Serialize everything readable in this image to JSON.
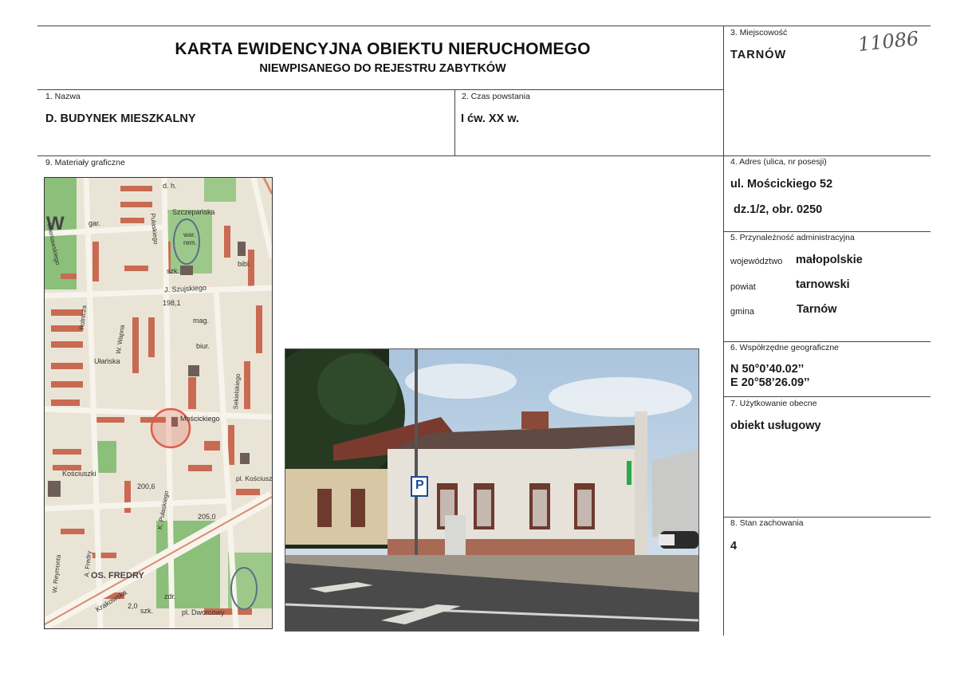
{
  "header": {
    "title": "KARTA EWIDENCYJNA OBIEKTU NIERUCHOMEGO",
    "subtitle": "NIEWPISANEGO DO REJESTRU ZABYTKÓW"
  },
  "locality": {
    "label": "3. Miejscowość",
    "value": "TARNÓW",
    "handwritten_number": "11086"
  },
  "name": {
    "label": "1. Nazwa",
    "value": "D. BUDYNEK MIESZKALNY"
  },
  "period": {
    "label": "2. Czas powstania",
    "value": "I ćw. XX w."
  },
  "graphics": {
    "label": "9. Materiały graficzne"
  },
  "address": {
    "label": "4. Adres (ulica, nr posesji)",
    "street": "ul. Mościckiego 52",
    "plot": "dz.1/2, obr. 0250"
  },
  "administration": {
    "label": "5. Przynależność administracyjna",
    "rows": [
      {
        "key": "województwo",
        "value": "małopolskie"
      },
      {
        "key": "powiat",
        "value": "tarnowski"
      },
      {
        "key": "gmina",
        "value": "Tarnów"
      }
    ]
  },
  "coordinates": {
    "label": "6. Współrzędne geograficzne",
    "north": "N 50°0’40.02’’",
    "east": "E  20°58’26.09’’"
  },
  "usage": {
    "label": "7. Użytkowanie obecne",
    "value": "obiekt usługowy"
  },
  "condition": {
    "label": "8. Stan zachowania",
    "value": "4"
  },
  "map_labels": {
    "w": "W",
    "gar": "gar.",
    "dh": "d. h.",
    "szczepanska": "Szczepańska",
    "warrem": "war. rem.",
    "wieniawskiego": "Wieniawskiego",
    "pulaskiego": "Pułaskiego",
    "bibl": "bibl.",
    "szk": "szk.",
    "szujskiego": "J. Szujskiego",
    "h1981": "198,1",
    "mag": "mag.",
    "rolnicza": "Rolnicza",
    "wapna": "W. Wapna",
    "biur": "biur.",
    "ulanska": "Ułańska",
    "moscickiego": "Mościckiego",
    "sekielskiego": "Sekielskiego",
    "kosciuszki": "Kościuszki",
    "pkosciuszki": "pl. Kościuszki",
    "h2006": "200,6",
    "h2050": "205,0",
    "osfredry": "OS. FREDRY",
    "krakowska": "Krakowska",
    "h20": "2,0",
    "szk2": "szk.",
    "pldworcowy": "pl. Dworcowy",
    "reymonta": "W. Reymonta",
    "fredry": "A. Fredry",
    "kpulaskiego": "K. Pułaskiego",
    "zdr": "zdr."
  },
  "photo_labels": {
    "parking": "P"
  },
  "colors": {
    "frame_line": "#444444",
    "map_street": "#f2efe6",
    "map_green": "#7fb06e",
    "map_building": "#c96a52",
    "marker": "#e05a4a"
  }
}
